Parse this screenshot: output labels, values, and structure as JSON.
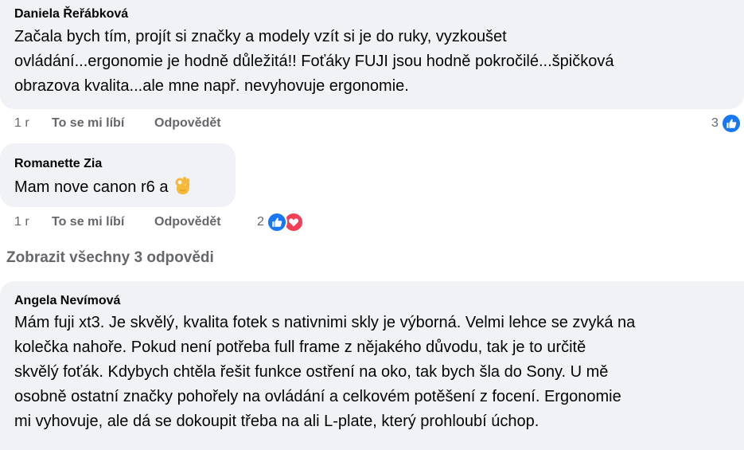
{
  "comments": [
    {
      "author": "Daniela Řeřábková",
      "lines": [
        "Začala bych tím, projít si značky a modely vzít si je do ruky, vyzkoušet",
        "ovládání...ergonomie je hodně důležitá!! Foťáky FUJI jsou hodně pokročilé...špičková",
        "obrazova kvalita...ale mne např. nevyhovuje ergonomie."
      ],
      "time": "1 r",
      "like_label": "To se mi líbí",
      "reply_label": "Odpovědět",
      "reaction_count": "3"
    },
    {
      "author": "Romanette Zia",
      "text": "Mam nove canon r6 a",
      "emoji": "ok-hand-emoji",
      "time": "1 r",
      "like_label": "To se mi líbí",
      "reply_label": "Odpovědět",
      "reaction_count": "2"
    },
    {
      "author": "Angela Nevímová",
      "lines": [
        "Mám fuji xt3. Je skvělý, kvalita fotek s nativnimi skly je výborná. Velmi lehce se zvyká na",
        "kolečka nahoře. Pokud není potřeba full frame z nějakého důvodu, tak je to určitě",
        "skvělý foťák. Kdybych chtěla řešit funkce ostření na oko, tak bych šla do Sony. U mě",
        "osobně ostatní značky pohořely na ovládání a celkovém potěšení z focení. Ergonomie",
        "mi vyhovuje, ale dá se dokoupit třeba na ali L-plate, který prohloubí úchop."
      ]
    }
  ],
  "view_replies_label": "Zobrazit všechny 3 odpovědi",
  "colors": {
    "bubble": "#f0f2f5",
    "secondary_text": "#65676b",
    "like_blue": "#1877f2",
    "love_red": "#f33e58"
  },
  "icons": [
    "like-icon",
    "love-icon",
    "ok-hand-emoji"
  ]
}
